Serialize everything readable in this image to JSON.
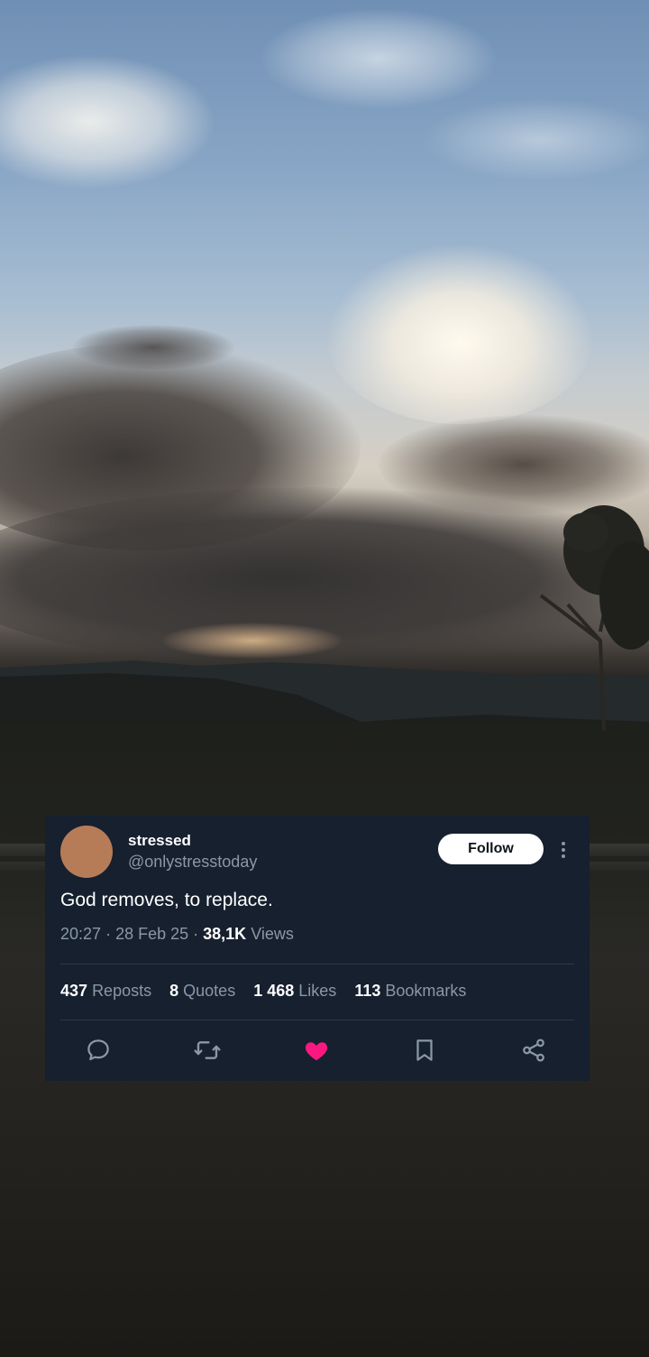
{
  "post": {
    "display_name": "stressed",
    "handle": "@onlystresstoday",
    "follow_label": "Follow",
    "text": "God removes, to replace.",
    "time": "20:27",
    "date": "28 Feb 25",
    "views_count": "38,1K",
    "views_label": "Views",
    "stats": {
      "reposts_count": "437",
      "reposts_label": "Reposts",
      "quotes_count": "8",
      "quotes_label": "Quotes",
      "likes_count": "1 468",
      "likes_label": "Likes",
      "bookmarks_count": "113",
      "bookmarks_label": "Bookmarks"
    },
    "actions": [
      "reply-icon",
      "repost-icon",
      "like-icon",
      "bookmark-icon",
      "share-icon"
    ],
    "liked": true
  },
  "colors": {
    "card_bg": "#16202e",
    "like_active": "#f91880",
    "avatar": "#b67c58",
    "muted_text": "#8b98a5"
  }
}
